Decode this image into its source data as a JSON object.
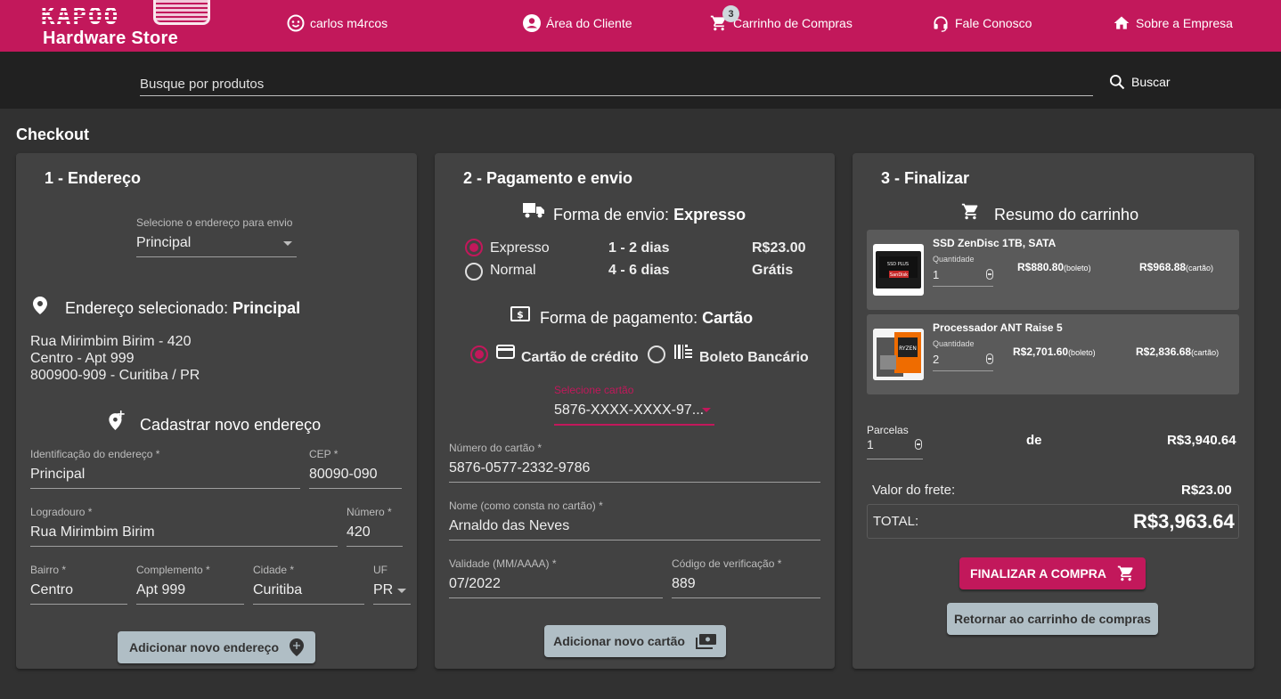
{
  "header": {
    "logo_brand": "KAPOO",
    "logo_sub": "Hardware Store",
    "user": "carlos m4rcos",
    "client_area": "Área do Cliente",
    "cart": "Carrinho de Compras",
    "cart_count": "3",
    "contact": "Fale Conosco",
    "about": "Sobre a Empresa"
  },
  "search": {
    "placeholder": "Busque por produtos",
    "button": "Buscar"
  },
  "page_title": "Checkout",
  "address": {
    "title": "1 - Endereço",
    "select_label": "Selecione o endereço para envio",
    "select_value": "Principal",
    "selected_prefix": "Endereço selecionado: ",
    "selected_name": "Principal",
    "line1": "Rua Mirimbim Birim - 420",
    "line2": "Centro - Apt 999",
    "line3": "800900-909 - Curitiba / PR",
    "new_title": "Cadastrar novo endereço",
    "fields": {
      "id_label": "Identificação do endereço *",
      "id_value": "Principal",
      "cep_label": "CEP *",
      "cep_value": "80090-090",
      "street_label": "Logradouro *",
      "street_value": "Rua Mirimbim Birim",
      "number_label": "Número *",
      "number_value": "420",
      "district_label": "Bairro *",
      "district_value": "Centro",
      "complement_label": "Complemento *",
      "complement_value": "Apt 999",
      "city_label": "Cidade *",
      "city_value": "Curitiba",
      "uf_label": "UF",
      "uf_value": "PR"
    },
    "add_button": "Adicionar novo endereço"
  },
  "payment": {
    "title": "2 - Pagamento e envio",
    "shipping_prefix": "Forma de envio: ",
    "shipping_value": "Expresso",
    "options": [
      {
        "name": "Expresso",
        "time": "1 - 2 dias",
        "price": "R$23.00",
        "selected": true
      },
      {
        "name": "Normal",
        "time": "4 - 6 dias",
        "price": "Grátis",
        "selected": false
      }
    ],
    "payment_prefix": "Forma de pagamento: ",
    "payment_value": "Cartão",
    "credit_label": "Cartão de crédito",
    "boleto_label": "Boleto Bancário",
    "card_select_label": "Selecione cartão",
    "card_select_value": "5876-XXXX-XXXX-97...",
    "card_number_label": "Número do cartão *",
    "card_number_value": "5876-0577-2332-9786",
    "holder_label": "Nome (como consta no cartão) *",
    "holder_value": "Arnaldo das Neves",
    "expiry_label": "Validade (MM/AAAA) *",
    "expiry_value": "07/2022",
    "cvv_label": "Código de verificação *",
    "cvv_value": "889",
    "add_card_button": "Adicionar novo cartão"
  },
  "finish": {
    "title": "3 - Finalizar",
    "summary_title": "Resumo do carrinho",
    "qty_label": "Quantidade",
    "boleto_tag": "(boleto)",
    "card_tag": "(cartão)",
    "items": [
      {
        "name": "SSD ZenDisc 1TB, SATA",
        "qty": "1",
        "price_boleto": "R$880.80",
        "price_card": "R$968.88"
      },
      {
        "name": "Processador ANT Raise 5",
        "qty": "2",
        "price_boleto": "R$2,701.60",
        "price_card": "R$2,836.68"
      }
    ],
    "installments_label": "Parcelas",
    "installments_value": "1",
    "of": "de",
    "installment_amount": "R$3,940.64",
    "shipping_label": "Valor do frete:",
    "shipping_value": "R$23.00",
    "total_label": "TOTAL:",
    "total_value": "R$3,963.64",
    "finish_button": "FINALIZAR A COMPRA",
    "back_button": "Retornar ao carrinho de compras"
  },
  "colors": {
    "accent": "#c2185b",
    "background": "#313131",
    "card": "#424242",
    "secondary_button": "#b0bec5"
  }
}
